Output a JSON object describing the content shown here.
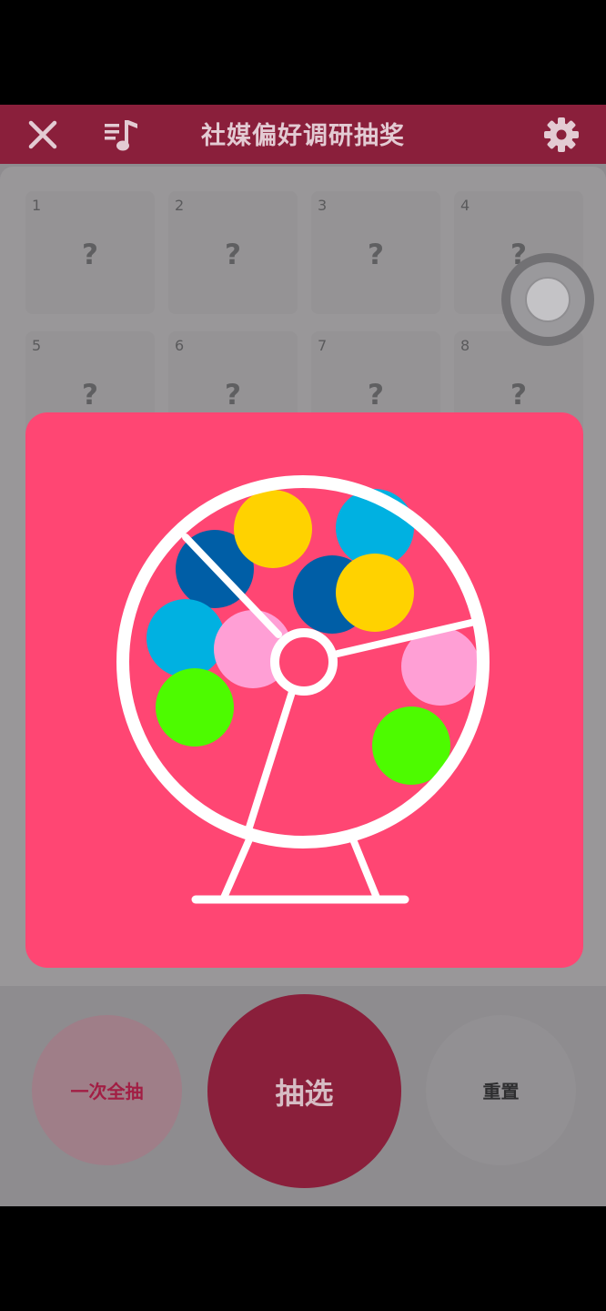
{
  "header": {
    "title": "社媒偏好调研抽奖",
    "close_icon": "close-icon",
    "playlist_icon": "music-playlist-icon",
    "settings_icon": "gear-icon",
    "color": "#8a1f3b"
  },
  "grid": {
    "tiles": [
      {
        "number": "1",
        "label": "?"
      },
      {
        "number": "2",
        "label": "?"
      },
      {
        "number": "3",
        "label": "?"
      },
      {
        "number": "4",
        "label": "?"
      },
      {
        "number": "5",
        "label": "?"
      },
      {
        "number": "6",
        "label": "?"
      },
      {
        "number": "7",
        "label": "?"
      },
      {
        "number": "8",
        "label": "?"
      }
    ]
  },
  "modal": {
    "illustration": "lottery-drum-icon",
    "background": "#ff4673",
    "ball_colors": [
      "#005ea6",
      "#ffd200",
      "#00b1e1",
      "#ff9fd5",
      "#4dfb00"
    ]
  },
  "actions": {
    "draw_all_label": "一次全抽",
    "draw_label": "抽选",
    "reset_label": "重置"
  }
}
